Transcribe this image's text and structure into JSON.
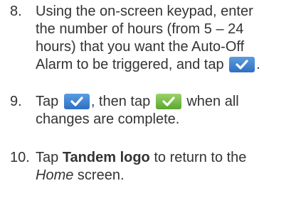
{
  "steps": [
    {
      "number": "8.",
      "line1": "Using the on-screen keypad, enter",
      "line2": "the number of hours (from 5 – 24",
      "line3": "hours) that you want the Auto-Off",
      "line4_pre": "Alarm to be triggered, and tap",
      "line4_post": "."
    },
    {
      "number": "9.",
      "line1_a": "Tap",
      "line1_b": ", then tap",
      "line1_c": "when all",
      "line2": "changes are complete."
    },
    {
      "number": "10.",
      "line1_a": "Tap",
      "line1_bold": "Tandem logo",
      "line1_b": "to return to the",
      "line2_ital": "Home",
      "line2_rest": "screen."
    }
  ],
  "icons": {
    "blue_check": "check-icon-blue",
    "green_check": "check-icon-green"
  },
  "colors": {
    "text": "#333333",
    "blue_button": "#3f82d4",
    "green_button": "#77bf46"
  }
}
